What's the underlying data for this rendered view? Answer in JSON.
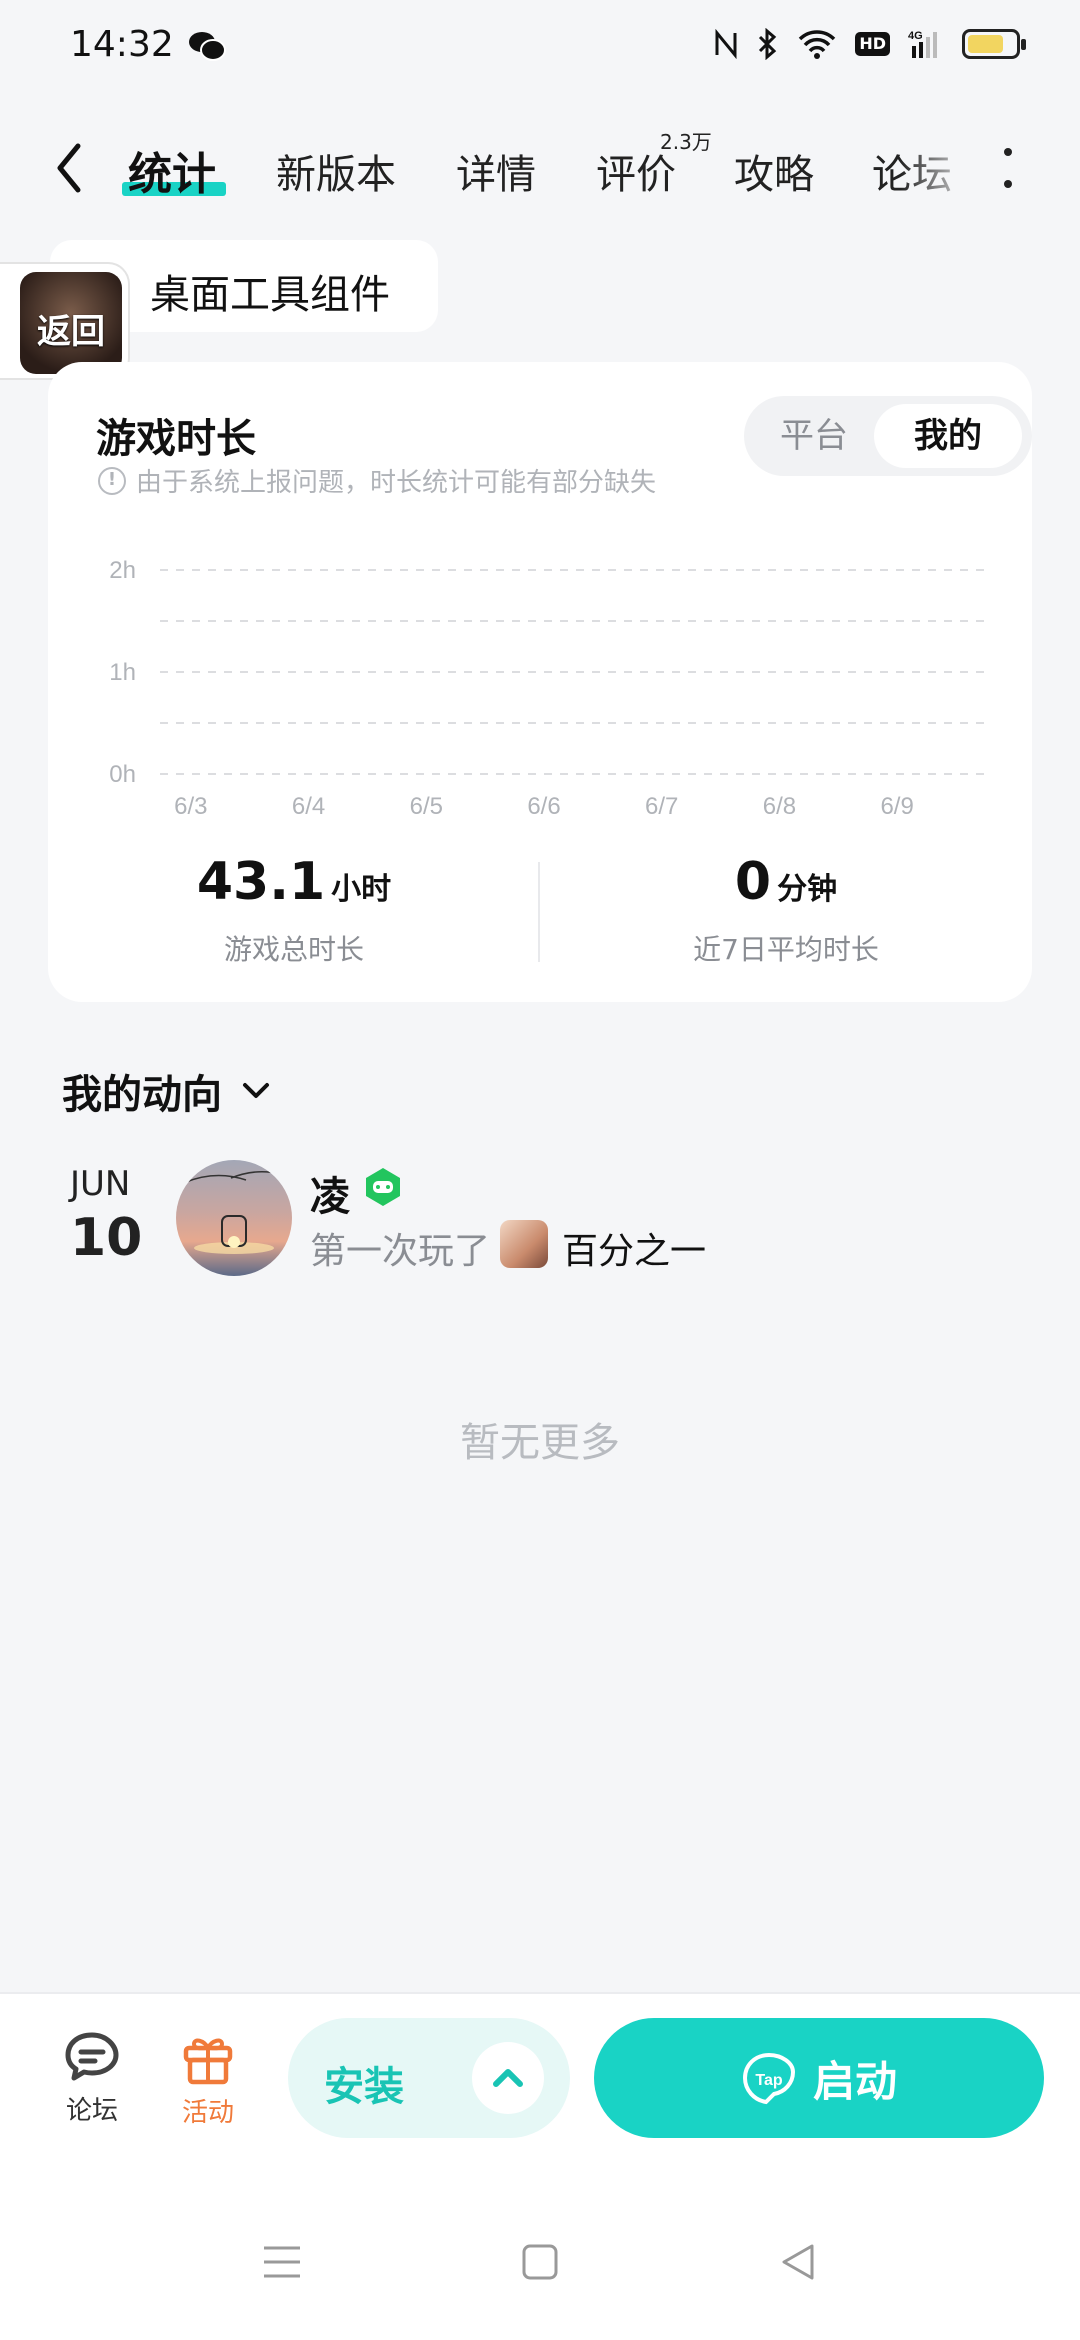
{
  "status_bar": {
    "time": "14:32",
    "network": "4G",
    "hd": "HD",
    "battery_level": 0.75
  },
  "nav": {
    "tabs": [
      {
        "label": "统计",
        "active": true
      },
      {
        "label": "新版本"
      },
      {
        "label": "详情"
      },
      {
        "label": "评价",
        "badge": "2.3万"
      },
      {
        "label": "攻略"
      },
      {
        "label": "论坛"
      }
    ]
  },
  "widget_chip": {
    "label": "桌面工具组件"
  },
  "return_float": {
    "label": "返回"
  },
  "playtime_card": {
    "title": "游戏时长",
    "note": "由于系统上报问题，时长统计可能有部分缺失",
    "toggle": {
      "platform": "平台",
      "mine": "我的",
      "selected": "我的"
    },
    "summary": {
      "total_value": "43.1",
      "total_unit": "小时",
      "total_label": "游戏总时长",
      "avg_value": "0",
      "avg_unit": "分钟",
      "avg_label": "近7日平均时长"
    }
  },
  "chart_data": {
    "type": "bar",
    "title": "",
    "categories": [
      "6/3",
      "6/4",
      "6/5",
      "6/6",
      "6/7",
      "6/8",
      "6/9"
    ],
    "values": [
      0,
      0,
      0,
      0,
      0,
      0,
      0
    ],
    "y_ticks": [
      "2h",
      "1h",
      "0h"
    ],
    "ylim": [
      0,
      2
    ],
    "grid": true,
    "colors": {
      "grid": "#dcdde0",
      "tick": "#b0b3b8"
    }
  },
  "activity": {
    "title": "我的动向",
    "items": [
      {
        "month": "JUN",
        "day": "10",
        "user": "凌",
        "text": "第一次玩了",
        "game": "百分之一"
      }
    ],
    "empty_text": "暂无更多"
  },
  "bottom_bar": {
    "forum_label": "论坛",
    "activity_label": "活动",
    "install_label": "安装",
    "launch_label": "启动",
    "tap_text": "Tap"
  },
  "colors": {
    "accent": "#19d3c5",
    "activity_orange": "#f07a3a"
  }
}
